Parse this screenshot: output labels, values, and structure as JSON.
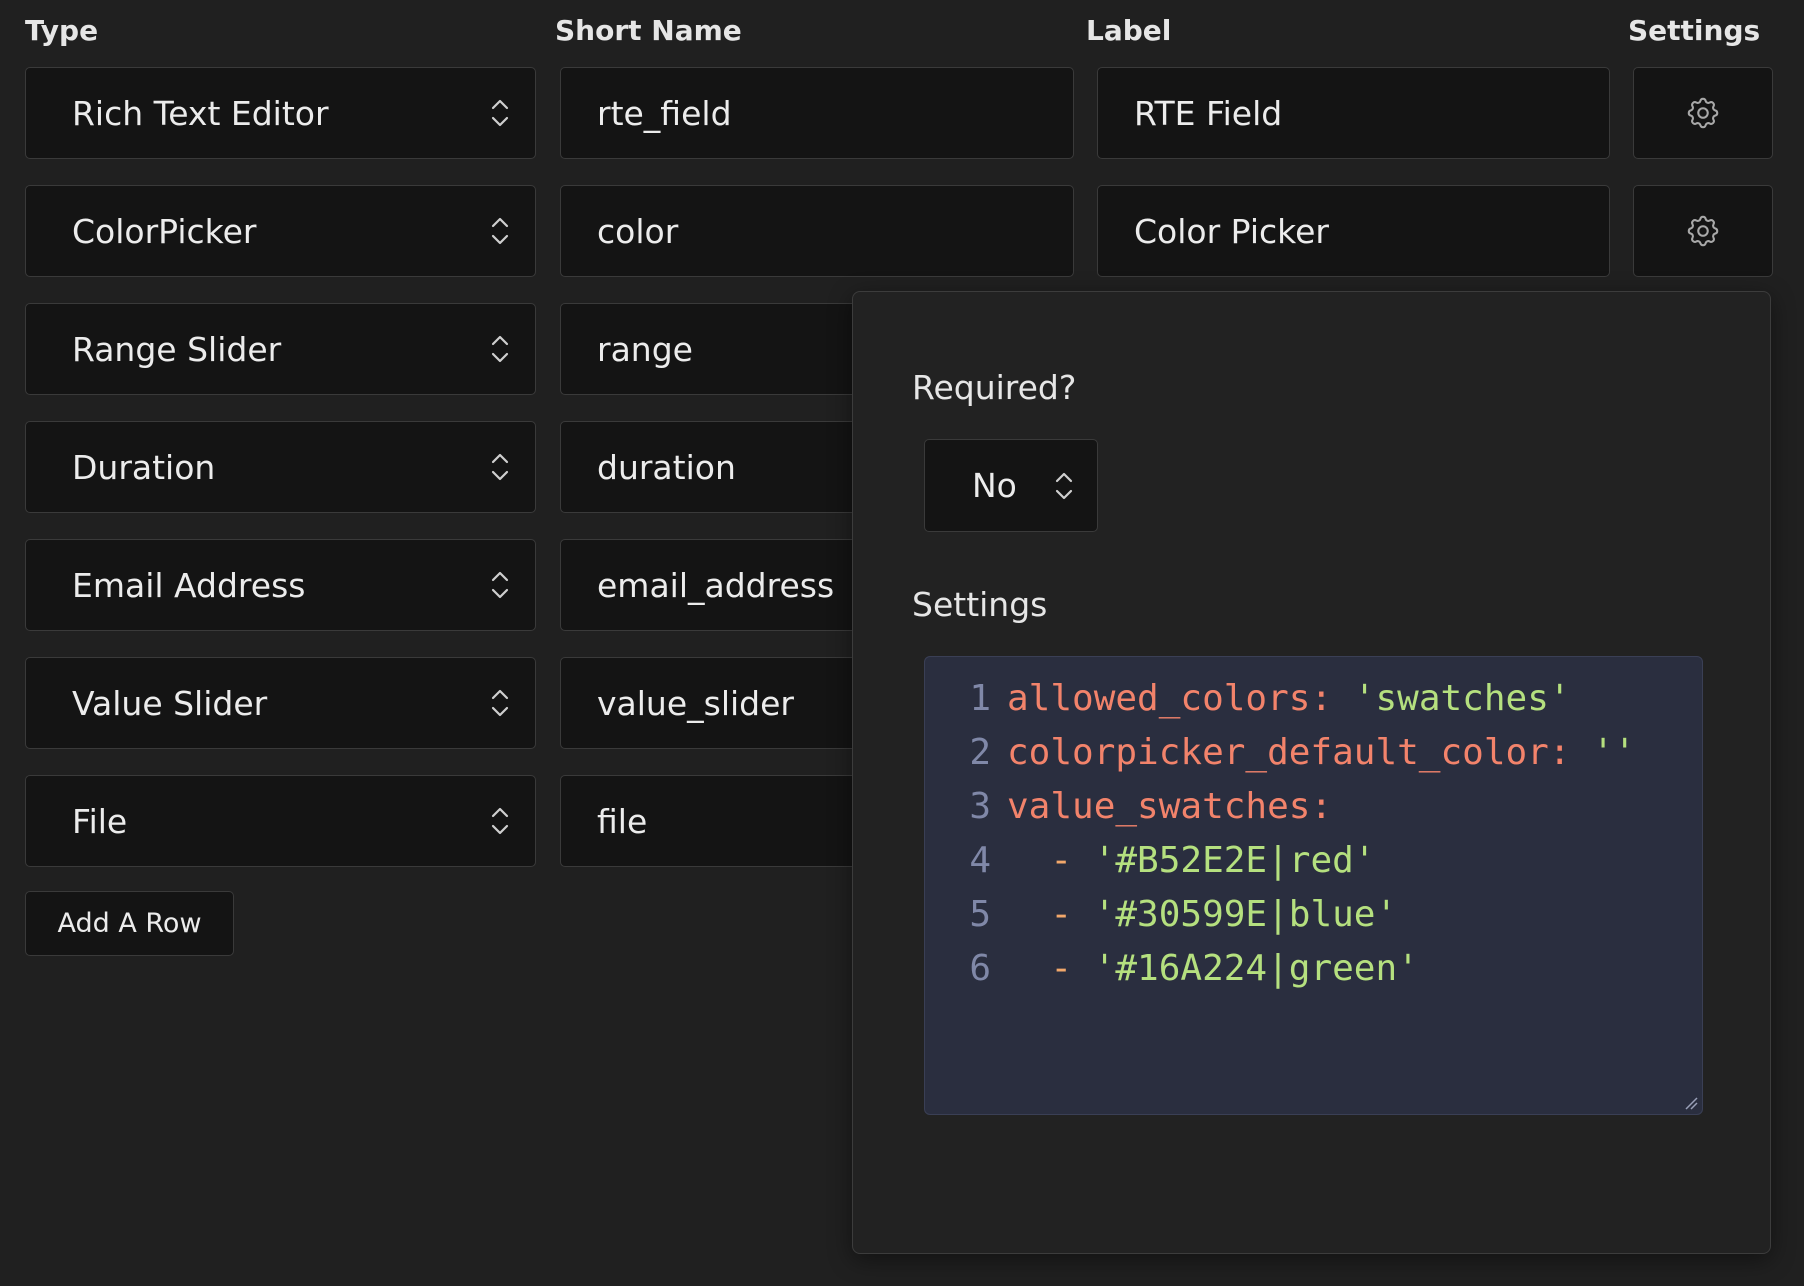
{
  "headers": {
    "type": "Type",
    "short_name": "Short Name",
    "label": "Label",
    "settings": "Settings"
  },
  "rows": [
    {
      "type": "Rich Text Editor",
      "short_name": "rte_field",
      "label": "RTE Field"
    },
    {
      "type": "ColorPicker",
      "short_name": "color",
      "label": "Color Picker"
    },
    {
      "type": "Range Slider",
      "short_name": "range",
      "label": ""
    },
    {
      "type": "Duration",
      "short_name": "duration",
      "label": ""
    },
    {
      "type": "Email Address",
      "short_name": "email_address",
      "label": ""
    },
    {
      "type": "Value Slider",
      "short_name": "value_slider",
      "label": ""
    },
    {
      "type": "File",
      "short_name": "file",
      "label": ""
    }
  ],
  "add_row_label": "Add A Row",
  "settings_popover": {
    "required_label": "Required?",
    "required_value": "No",
    "settings_label": "Settings",
    "code_lines": [
      {
        "num": "1",
        "key": "allowed_colors",
        "colon": ": ",
        "value": "'swatches'",
        "dash": ""
      },
      {
        "num": "2",
        "key": "colorpicker_default_color",
        "colon": ": ",
        "value": "''",
        "dash": ""
      },
      {
        "num": "3",
        "key": "value_swatches",
        "colon": ":",
        "value": "",
        "dash": ""
      },
      {
        "num": "4",
        "key": "",
        "colon": "",
        "value": "'#B52E2E|red'",
        "dash": "  - "
      },
      {
        "num": "5",
        "key": "",
        "colon": "",
        "value": "'#30599E|blue'",
        "dash": "  - "
      },
      {
        "num": "6",
        "key": "",
        "colon": "",
        "value": "'#16A224|green'",
        "dash": "  - "
      }
    ]
  },
  "icons": {
    "select_chevron": "chevron-up-down-icon",
    "settings": "gear-icon",
    "resize": "resize-handle-icon"
  },
  "colors": {
    "background": "#202020",
    "field_background": "#141414",
    "code_background": "#2a2e3f",
    "code_key": "#f2836b",
    "code_string": "#b5e07f",
    "code_line_number": "#8088a8"
  }
}
